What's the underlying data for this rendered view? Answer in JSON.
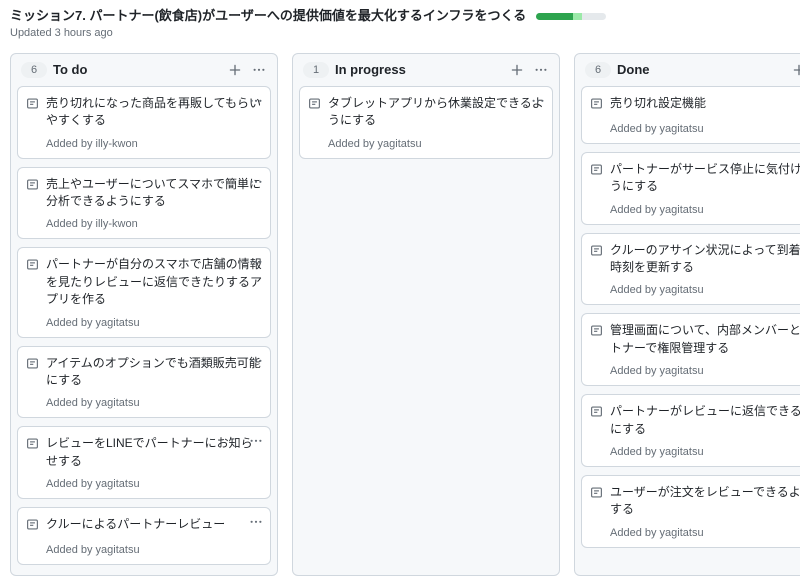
{
  "header": {
    "title": "ミッション7. パートナー(飲食店)がユーザーへの提供価値を最大化するインフラをつくる",
    "progress_percent": 65,
    "updated_label": "Updated 3 hours ago"
  },
  "added_prefix": "Added by ",
  "columns": [
    {
      "id": "todo",
      "count": "6",
      "title": "To do",
      "cards": [
        {
          "title": "売り切れになった商品を再販してもらいやすくする",
          "added_by": "illy-kwon"
        },
        {
          "title": "売上やユーザーについてスマホで簡単に分析できるようにする",
          "added_by": "illy-kwon"
        },
        {
          "title": "パートナーが自分のスマホで店舗の情報を見たりレビューに返信できたりするアプリを作る",
          "added_by": "yagitatsu"
        },
        {
          "title": "アイテムのオプションでも酒類販売可能にする",
          "added_by": "yagitatsu"
        },
        {
          "title": "レビューをLINEでパートナーにお知らせする",
          "added_by": "yagitatsu"
        },
        {
          "title": "クルーによるパートナーレビュー",
          "added_by": "yagitatsu"
        }
      ]
    },
    {
      "id": "inprogress",
      "count": "1",
      "title": "In progress",
      "cards": [
        {
          "title": "タブレットアプリから休業設定できるようにする",
          "added_by": "yagitatsu"
        }
      ]
    },
    {
      "id": "done",
      "count": "6",
      "title": "Done",
      "cards": [
        {
          "title": "売り切れ設定機能",
          "added_by": "yagitatsu"
        },
        {
          "title": "パートナーがサービス停止に気付けるようにする",
          "added_by": "yagitatsu"
        },
        {
          "title": "クルーのアサイン状況によって到着目安時刻を更新する",
          "added_by": "yagitatsu"
        },
        {
          "title": "管理画面について、内部メンバーとパートナーで権限管理する",
          "added_by": "yagitatsu"
        },
        {
          "title": "パートナーがレビューに返信できるようにする",
          "added_by": "yagitatsu"
        },
        {
          "title": "ユーザーが注文をレビューできるようにする",
          "added_by": "yagitatsu"
        }
      ]
    }
  ]
}
